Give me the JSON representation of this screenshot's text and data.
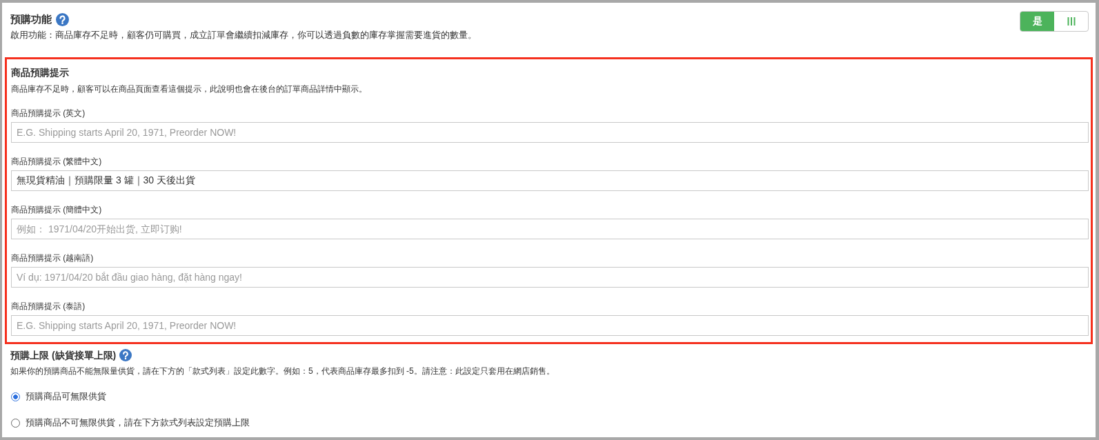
{
  "preorder": {
    "title": "預購功能",
    "description": "啟用功能：商品庫存不足時，顧客仍可購買，成立訂單會繼續扣減庫存，你可以透過負數的庫存掌握需要進貨的數量。",
    "toggle": {
      "label": "是",
      "on": true
    }
  },
  "preorder_notice": {
    "highlighted": true,
    "title": "商品預購提示",
    "description": "商品庫存不足時，顧客可以在商品頁面查看這個提示，此說明也會在後台的訂單商品詳情中顯示。",
    "fields": [
      {
        "label": "商品預購提示 (英文)",
        "placeholder": "E.G. Shipping starts April 20, 1971, Preorder NOW!"
      },
      {
        "label": "商品預購提示 (繁體中文)",
        "value": "無現貨精油｜預購限量 3 罐｜30 天後出貨"
      },
      {
        "label": "商品預購提示 (簡體中文)",
        "placeholder": "例如： 1971/04/20开始出货, 立即订购!"
      },
      {
        "label": "商品預購提示 (越南語)",
        "placeholder": "Ví dụ: 1971/04/20 bắt đầu giao hàng, đặt hàng ngay!"
      },
      {
        "label": "商品預購提示 (泰語)",
        "placeholder": "E.G. Shipping starts April 20, 1971, Preorder NOW!"
      }
    ]
  },
  "preorder_limit": {
    "title": "預購上限 (缺貨接單上限)",
    "description": "如果你的預購商品不能無限量供貨，請在下方的「款式列表」設定此數字。例如：5，代表商品庫存最多扣到 -5。請注意：此設定只套用在網店銷售。",
    "options": [
      {
        "label": "預購商品可無限供貨",
        "selected": true
      },
      {
        "label": "預購商品不可無限供貨，請在下方款式列表設定預購上限",
        "selected": false
      }
    ]
  }
}
